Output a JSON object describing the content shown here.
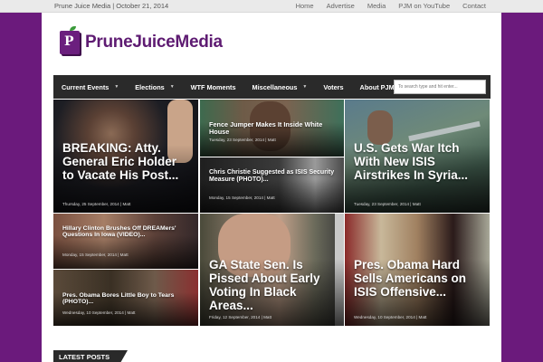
{
  "topbar": {
    "date_text": "Prune Juice Media | October 21, 2014",
    "links": [
      "Home",
      "Advertise",
      "Media",
      "PJM on YouTube",
      "Contact"
    ]
  },
  "logo": {
    "text": "PruneJuiceMedia",
    "letter": "P"
  },
  "nav": {
    "items": [
      {
        "label": "Current Events"
      },
      {
        "label": "Elections"
      },
      {
        "label": "WTF Moments"
      },
      {
        "label": "Miscellaneous"
      },
      {
        "label": "Voters"
      },
      {
        "label": "About PJM"
      }
    ],
    "search_placeholder": "To search type and hit enter..."
  },
  "tiles": [
    {
      "title": "BREAKING: Atty. General Eric Holder to Vacate His Post...",
      "meta": "Thursday, 25 September, 2014 | Matt"
    },
    {
      "title": "Fence Jumper Makes It Inside White House",
      "meta": "Tuesday, 23 September, 2014 | Matt"
    },
    {
      "title": "Chris Christie Suggested as ISIS Security Measure (PHOTO)...",
      "meta": "Monday, 15 September, 2014 | Matt"
    },
    {
      "title": "U.S. Gets War Itch With New ISIS Airstrikes In Syria...",
      "meta": "Tuesday, 23 September, 2014 | Matt"
    },
    {
      "title": "Hillary Clinton Brushes Off DREAMers' Questions In Iowa (VIDEO)...",
      "meta": "Monday, 15 September, 2014 | Matt"
    },
    {
      "title": "Pres. Obama Bores Little Boy to Tears (PHOTO)...",
      "meta": "Wednesday, 10 September, 2014 | Matt"
    },
    {
      "title": "GA State Sen. Is Pissed About Early Voting In Black Areas...",
      "meta": "Friday, 12 September, 2014 | Matt"
    },
    {
      "title": "Pres. Obama Hard Sells Americans on ISIS Offensive...",
      "meta": "Wednesday, 10 September, 2014 | Matt"
    }
  ],
  "latest_posts_label": "LATEST POSTS",
  "colors": {
    "brand_purple": "#6b1a7c",
    "nav_dark": "#2a2a2a",
    "topbar": "#eaeaea"
  }
}
